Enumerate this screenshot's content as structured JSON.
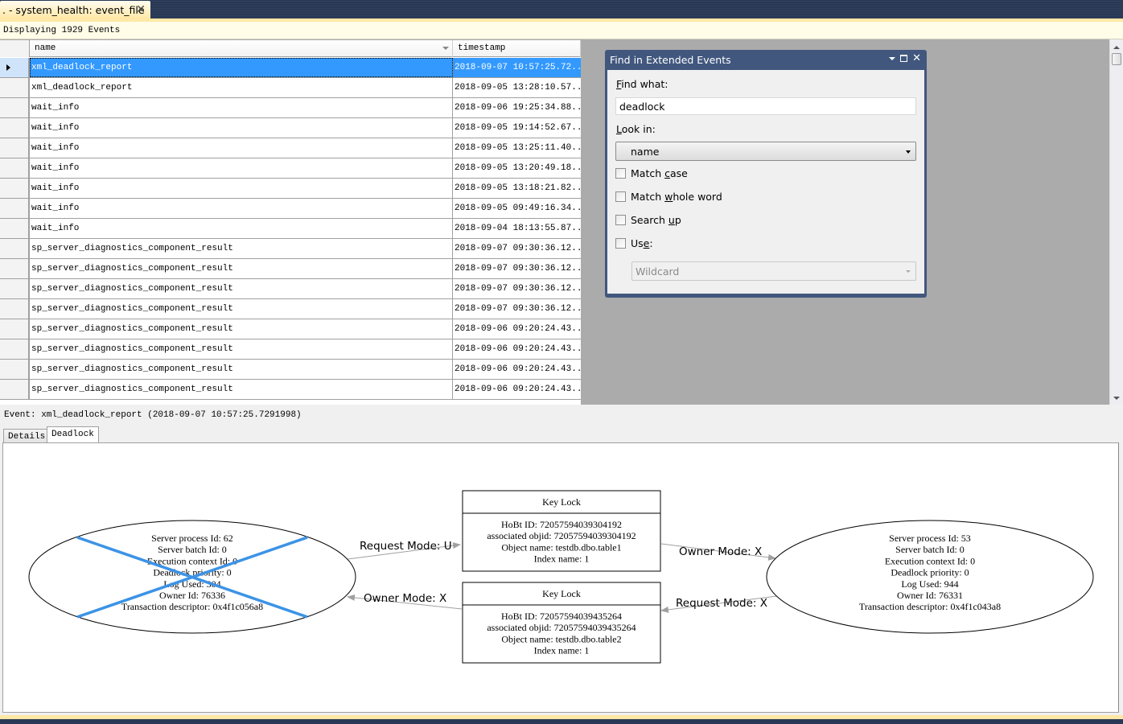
{
  "document_tab": {
    "title": ". - system_health: event_file",
    "close_icon": "✕"
  },
  "info_bar": {
    "text": "Displaying 1929 Events"
  },
  "grid": {
    "columns": [
      {
        "label": "name"
      },
      {
        "label": "timestamp"
      }
    ],
    "rows": [
      {
        "name": "xml_deadlock_report",
        "timestamp": "2018-09-07 10:57:25.72...",
        "selected": true
      },
      {
        "name": "xml_deadlock_report",
        "timestamp": "2018-09-05 13:28:10.57..."
      },
      {
        "name": "wait_info",
        "timestamp": "2018-09-06 19:25:34.88..."
      },
      {
        "name": "wait_info",
        "timestamp": "2018-09-05 19:14:52.67..."
      },
      {
        "name": "wait_info",
        "timestamp": "2018-09-05 13:25:11.40..."
      },
      {
        "name": "wait_info",
        "timestamp": "2018-09-05 13:20:49.18..."
      },
      {
        "name": "wait_info",
        "timestamp": "2018-09-05 13:18:21.82..."
      },
      {
        "name": "wait_info",
        "timestamp": "2018-09-05 09:49:16.34..."
      },
      {
        "name": "wait_info",
        "timestamp": "2018-09-04 18:13:55.87..."
      },
      {
        "name": "sp_server_diagnostics_component_result",
        "timestamp": "2018-09-07 09:30:36.12..."
      },
      {
        "name": "sp_server_diagnostics_component_result",
        "timestamp": "2018-09-07 09:30:36.12..."
      },
      {
        "name": "sp_server_diagnostics_component_result",
        "timestamp": "2018-09-07 09:30:36.12..."
      },
      {
        "name": "sp_server_diagnostics_component_result",
        "timestamp": "2018-09-07 09:30:36.12..."
      },
      {
        "name": "sp_server_diagnostics_component_result",
        "timestamp": "2018-09-06 09:20:24.43..."
      },
      {
        "name": "sp_server_diagnostics_component_result",
        "timestamp": "2018-09-06 09:20:24.43..."
      },
      {
        "name": "sp_server_diagnostics_component_result",
        "timestamp": "2018-09-06 09:20:24.43..."
      },
      {
        "name": "sp_server_diagnostics_component_result",
        "timestamp": "2018-09-06 09:20:24.43..."
      }
    ]
  },
  "find_dialog": {
    "title": "Find in Extended Events",
    "find_what_label_u": "F",
    "find_what_label_rest": "ind what:",
    "find_what_value": "deadlock",
    "look_in_label_u": "L",
    "look_in_label_rest": "ook in:",
    "look_in_value": "name",
    "options": [
      {
        "pre": "Match ",
        "u": "c",
        "post": "ase",
        "checked": false
      },
      {
        "pre": "Match ",
        "u": "w",
        "post": "hole word",
        "checked": false
      },
      {
        "pre": "Search ",
        "u": "u",
        "post": "p",
        "checked": false
      },
      {
        "pre": "Us",
        "u": "e",
        "post": ":",
        "checked": false
      }
    ],
    "use_type_value": "Wildcard"
  },
  "event_line": "Event: xml_deadlock_report (2018-09-07 10:57:25.7291998)",
  "detail_tabs": [
    {
      "label": "Details"
    },
    {
      "label": "Deadlock",
      "active": true
    }
  ],
  "deadlock_graph": {
    "victim_process": {
      "lines": [
        "Server process Id: 62",
        "Server batch Id: 0",
        "Execution context Id: 0",
        "Deadlock priority: 0",
        "Log Used: 304",
        "Owner Id: 76336",
        "Transaction descriptor: 0x4f1c056a8"
      ],
      "victim": true
    },
    "other_process": {
      "lines": [
        "Server process Id: 53",
        "Server batch Id: 0",
        "Execution context Id: 0",
        "Deadlock priority: 0",
        "Log Used: 944",
        "Owner Id: 76331",
        "Transaction descriptor: 0x4f1c043a8"
      ],
      "victim": false
    },
    "resources": [
      {
        "title": "Key Lock",
        "lines": [
          "HoBt ID: 72057594039304192",
          "associated objid: 72057594039304192",
          "Object name: testdb.dbo.table1",
          "Index name: 1"
        ]
      },
      {
        "title": "Key Lock",
        "lines": [
          "HoBt ID: 72057594039435264",
          "associated objid: 72057594039435264",
          "Object name: testdb.dbo.table2",
          "Index name: 1"
        ]
      }
    ],
    "edges": [
      {
        "label": "Request Mode: U"
      },
      {
        "label": "Owner Mode: X"
      },
      {
        "label": "Owner Mode: X"
      },
      {
        "label": "Request Mode: X"
      }
    ],
    "victim_cross_color": "#3c93e6"
  }
}
